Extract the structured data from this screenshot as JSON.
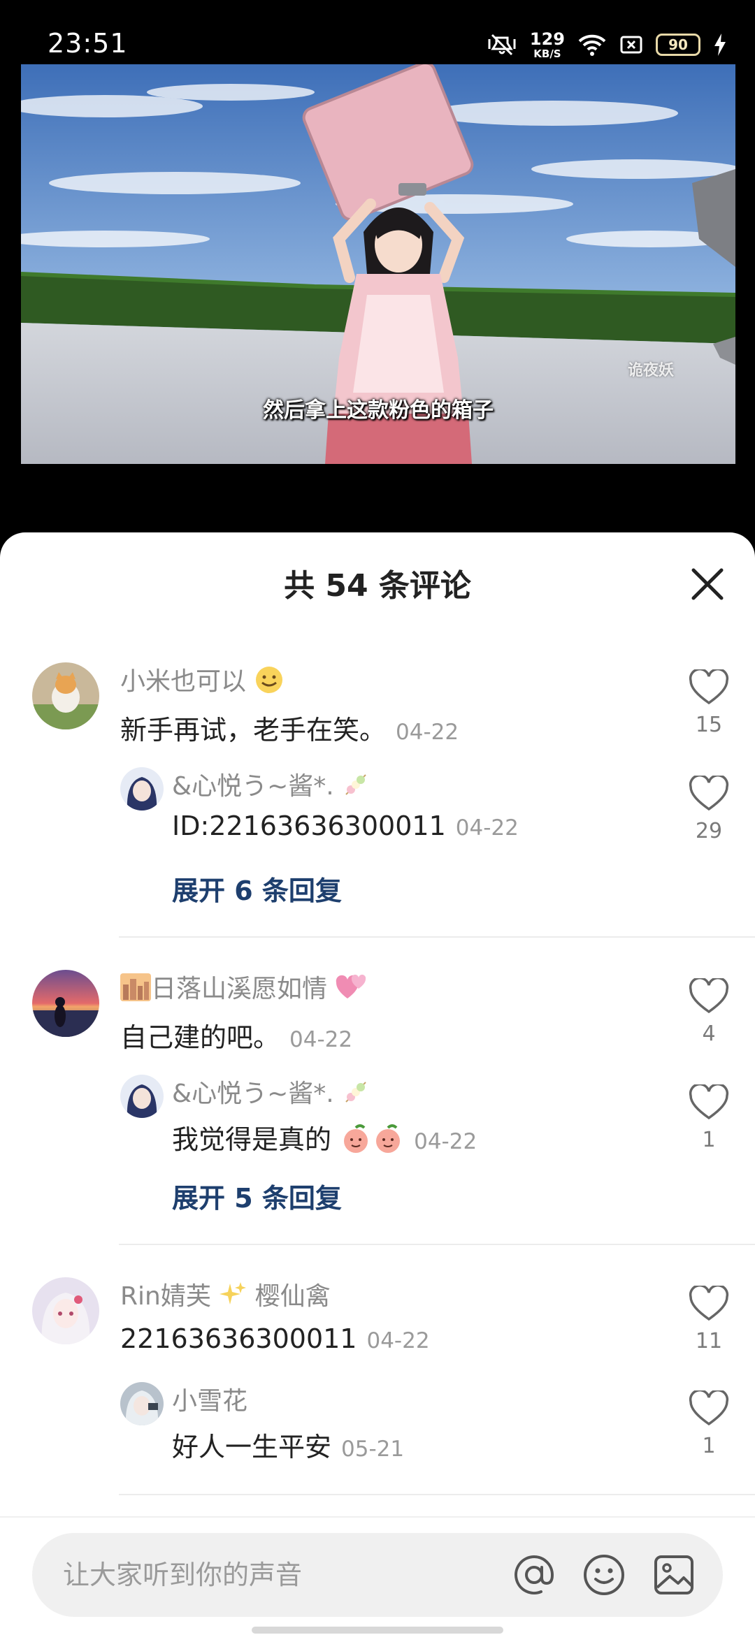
{
  "status_bar": {
    "time": "23:51",
    "net_speed_value": "129",
    "net_speed_unit": "KB/S",
    "battery_level": "90",
    "icons": [
      "mute-icon",
      "wifi-icon",
      "sim-icon",
      "battery-icon",
      "charging-icon"
    ]
  },
  "video": {
    "subtitle": "然后拿上这款粉色的箱子",
    "watermark": "诡夜妖"
  },
  "comments_panel": {
    "title": "共 54 条评论",
    "comments": [
      {
        "name": "小米也可以",
        "text": "新手再试，老手在笑。",
        "date": "04-22",
        "likes": "15",
        "reply": {
          "name": "&心悦う~酱*.",
          "text": "ID:22163636300011",
          "date": "04-22",
          "likes": "29"
        },
        "expand_label": "展开 6 条回复"
      },
      {
        "name": "日落山溪愿如情",
        "text": "自己建的吧。",
        "date": "04-22",
        "likes": "4",
        "reply": {
          "name": "&心悦う~酱*.",
          "text": "我觉得是真的",
          "date": "04-22",
          "likes": "1"
        },
        "expand_label": "展开 5 条回复"
      },
      {
        "name_part1": "Rin婧芙",
        "name_part2": "樱仙禽",
        "text": "22163636300011",
        "date": "04-22",
        "likes": "11",
        "reply": {
          "name": "小雪花",
          "text": "好人一生平安",
          "date": "05-21",
          "likes": "1"
        }
      }
    ]
  },
  "input": {
    "placeholder": "让大家听到你的声音",
    "icons": [
      "at-icon",
      "emoji-icon",
      "image-icon"
    ]
  },
  "colors": {
    "expand_link": "#1e3f6e",
    "name_gray": "#8a8a8a",
    "sheet_bg": "#ffffff"
  }
}
